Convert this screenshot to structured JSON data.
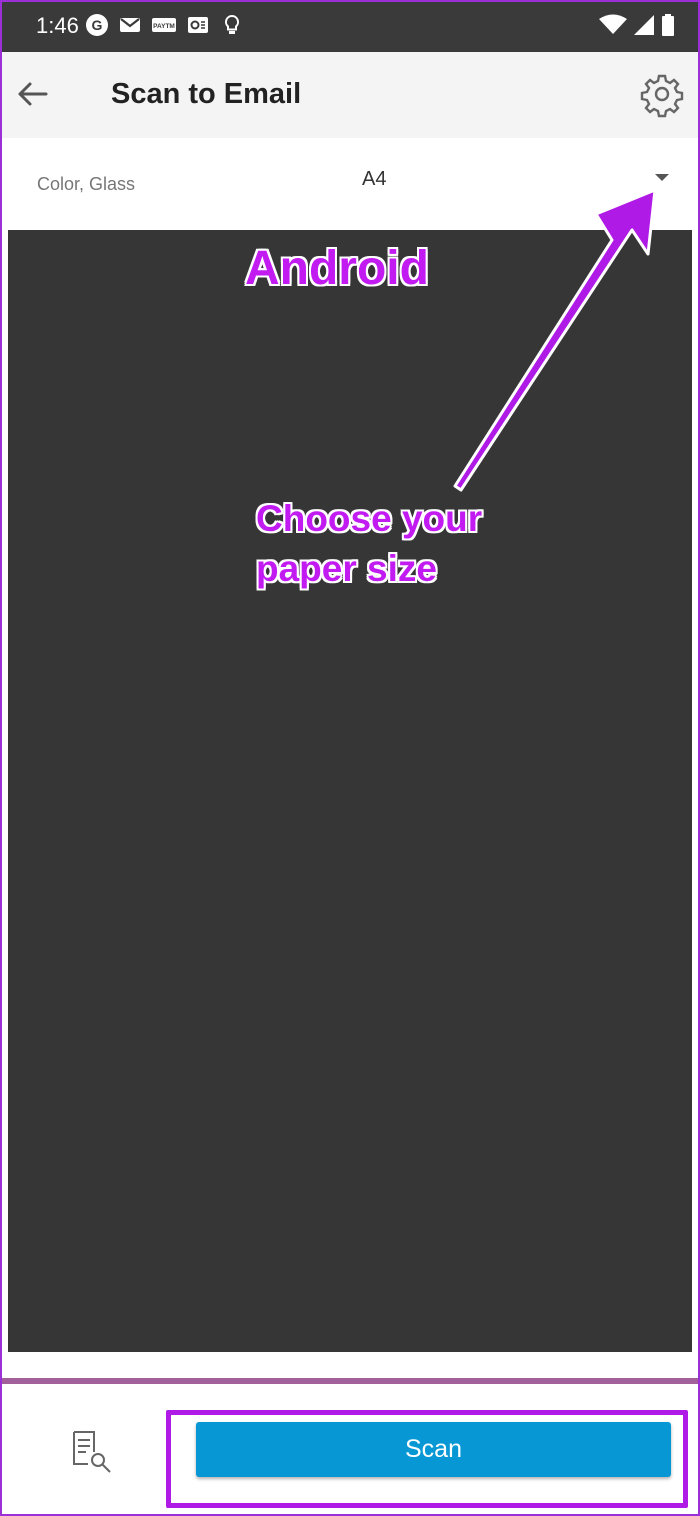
{
  "status_bar": {
    "time": "1:46",
    "icons": [
      "google-icon",
      "gmail-icon",
      "paytm-icon",
      "outlook-icon",
      "bulb-icon",
      "wifi-icon",
      "signal-icon",
      "battery-icon"
    ],
    "paytm_label": "PAYTM"
  },
  "app_bar": {
    "title": "Scan to Email",
    "back_icon": "back-arrow-icon",
    "settings_icon": "gear-icon"
  },
  "options": {
    "scan_settings": "Color, Glass",
    "paper_size": "A4",
    "dropdown_icon": "dropdown-triangle-icon"
  },
  "annotations": {
    "title": "Android",
    "note_line1": "Choose your",
    "note_line2": "paper size",
    "color": "#c21bf2"
  },
  "bottom_bar": {
    "preview_icon": "document-search-icon",
    "scan_label": "Scan",
    "scan_color": "#0797d5",
    "highlight_color": "#b01ae6"
  }
}
